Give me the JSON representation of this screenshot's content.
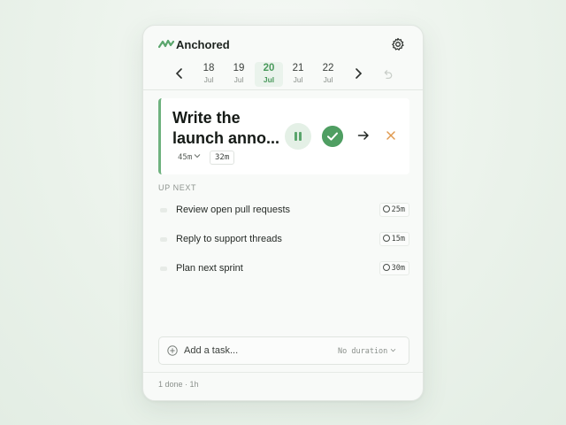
{
  "app": {
    "title": "Anchored"
  },
  "icons": {
    "logo": "anchor-wave-logo",
    "settings": "gear-icon",
    "prev": "chevron-left-icon",
    "next": "chevron-right-icon",
    "undo": "undo-icon"
  },
  "dates": [
    {
      "day": "18",
      "month": "Jul",
      "active": false
    },
    {
      "day": "19",
      "month": "Jul",
      "active": false
    },
    {
      "day": "20",
      "month": "Jul",
      "active": true
    },
    {
      "day": "21",
      "month": "Jul",
      "active": false
    },
    {
      "day": "22",
      "month": "Jul",
      "active": false
    }
  ],
  "current": {
    "title": "Write the launch anno...",
    "estimate": "45m",
    "elapsed": "32m"
  },
  "queue": {
    "heading": "UP NEXT",
    "items": [
      {
        "label": "Review open pull requests",
        "duration": "25m"
      },
      {
        "label": "Reply to support threads",
        "duration": "15m"
      },
      {
        "label": "Plan next sprint",
        "duration": "30m"
      }
    ]
  },
  "add": {
    "placeholder": "Add a task...",
    "duration": "No duration"
  },
  "footer": {
    "summary": "1 done · 1h"
  },
  "colors": {
    "accent": "#4f9e62",
    "accent_light": "#e4f0e6",
    "skip": "#e09a4f"
  }
}
